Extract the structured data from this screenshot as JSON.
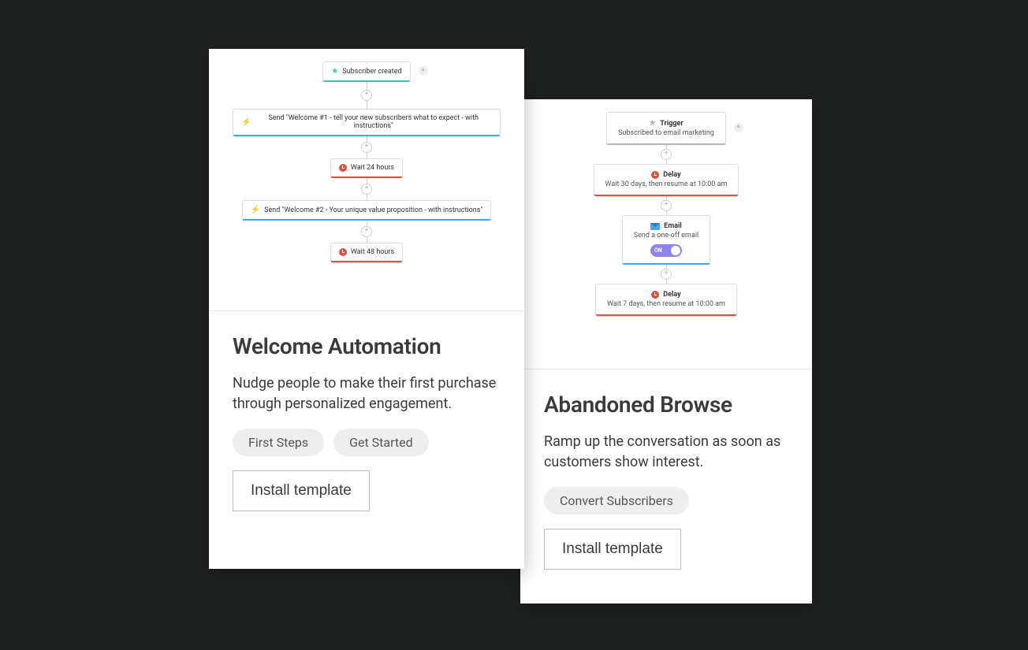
{
  "cards": [
    {
      "title": "Welcome Automation",
      "description": "Nudge people to make their first purchase through personalized engagement.",
      "tags": [
        "First Steps",
        "Get Started"
      ],
      "install_label": "Install template",
      "flow": [
        {
          "kind": "trigger",
          "icon": "star",
          "accent": "green",
          "label": "Subscriber created"
        },
        {
          "kind": "action",
          "icon": "bolt",
          "accent": "blue",
          "label": "Send \"Welcome #1 - tell your new subscribers what to expect - with instructions\""
        },
        {
          "kind": "delay",
          "icon": "clock",
          "accent": "red",
          "label": "Wait 24 hours"
        },
        {
          "kind": "action",
          "icon": "bolt",
          "accent": "blue",
          "label": "Send \"Welcome #2 - Your unique value proposition - with instructions\""
        },
        {
          "kind": "delay",
          "icon": "clock",
          "accent": "red",
          "label": "Wait 48 hours"
        }
      ]
    },
    {
      "title": "Abandoned Browse",
      "description": "Ramp up the conversation as soon as customers show interest.",
      "tags": [
        "Convert Subscribers"
      ],
      "install_label": "Install template",
      "flow": [
        {
          "kind": "trigger",
          "icon": "star-grey",
          "accent": "grey",
          "title": "Trigger",
          "label": "Subscribed to email marketing"
        },
        {
          "kind": "delay",
          "icon": "clock",
          "accent": "red",
          "title": "Delay",
          "label": "Wait 30 days, then resume at 10:00 am"
        },
        {
          "kind": "email",
          "icon": "mail",
          "accent": "blue",
          "title": "Email",
          "label": "Send a one-off email",
          "toggle": "ON"
        },
        {
          "kind": "delay",
          "icon": "clock",
          "accent": "red",
          "title": "Delay",
          "label": "Wait 7 days, then resume at 10:00 am"
        }
      ]
    }
  ]
}
